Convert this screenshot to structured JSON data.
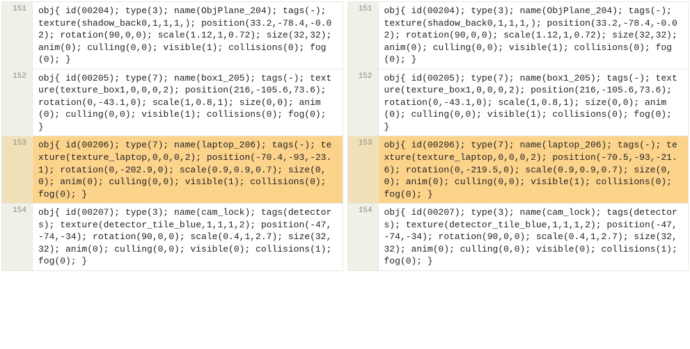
{
  "diff": {
    "left": {
      "rows": [
        {
          "lineno": "151",
          "changed": false,
          "text": "obj{ id(00204); type(3); name(ObjPlane_204); tags(-); texture(shadow_back0,1,1,1,); position(33.2,-78.4,-0.02); rotation(90,0,0); scale(1.12,1,0.72); size(32,32); anim(0); culling(0,0); visible(1); collisions(0); fog(0); }"
        },
        {
          "lineno": "152",
          "changed": false,
          "text": "obj{ id(00205); type(7); name(box1_205); tags(-); texture(texture_box1,0,0,0,2); position(216,-105.6,73.6); rotation(0,-43.1,0); scale(1,0.8,1); size(0,0); anim(0); culling(0,0); visible(1); collisions(0); fog(0); }"
        },
        {
          "lineno": "153",
          "changed": true,
          "text": "obj{ id(00206); type(7); name(laptop_206); tags(-); texture(texture_laptop,0,0,0,2); position(-70.4,-93,-23.1); rotation(0,-202.9,0); scale(0.9,0.9,0.7); size(0,0); anim(0); culling(0,0); visible(1); collisions(0); fog(0); }"
        },
        {
          "lineno": "154",
          "changed": false,
          "text": "obj{ id(00207); type(3); name(cam_lock); tags(detectors); texture(detector_tile_blue,1,1,1,2); position(-47,-74,-34); rotation(90,0,0); scale(0.4,1,2.7); size(32,32); anim(0); culling(0,0); visible(0); collisions(1); fog(0); }"
        }
      ]
    },
    "right": {
      "rows": [
        {
          "lineno": "151",
          "changed": false,
          "text": "obj{ id(00204); type(3); name(ObjPlane_204); tags(-); texture(shadow_back0,1,1,1,); position(33.2,-78.4,-0.02); rotation(90,0,0); scale(1.12,1,0.72); size(32,32); anim(0); culling(0,0); visible(1); collisions(0); fog(0); }"
        },
        {
          "lineno": "152",
          "changed": false,
          "text": "obj{ id(00205); type(7); name(box1_205); tags(-); texture(texture_box1,0,0,0,2); position(216,-105.6,73.6); rotation(0,-43.1,0); scale(1,0.8,1); size(0,0); anim(0); culling(0,0); visible(1); collisions(0); fog(0); }"
        },
        {
          "lineno": "153",
          "changed": true,
          "text": "obj{ id(00206); type(7); name(laptop_206); tags(-); texture(texture_laptop,0,0,0,2); position(-70.5,-93,-21.6); rotation(0,-219.5,0); scale(0.9,0.9,0.7); size(0,0); anim(0); culling(0,0); visible(1); collisions(0); fog(0); }"
        },
        {
          "lineno": "154",
          "changed": false,
          "text": "obj{ id(00207); type(3); name(cam_lock); tags(detectors); texture(detector_tile_blue,1,1,1,2); position(-47,-74,-34); rotation(90,0,0); scale(0.4,1,2.7); size(32,32); anim(0); culling(0,0); visible(0); collisions(1); fog(0); }"
        }
      ]
    }
  }
}
